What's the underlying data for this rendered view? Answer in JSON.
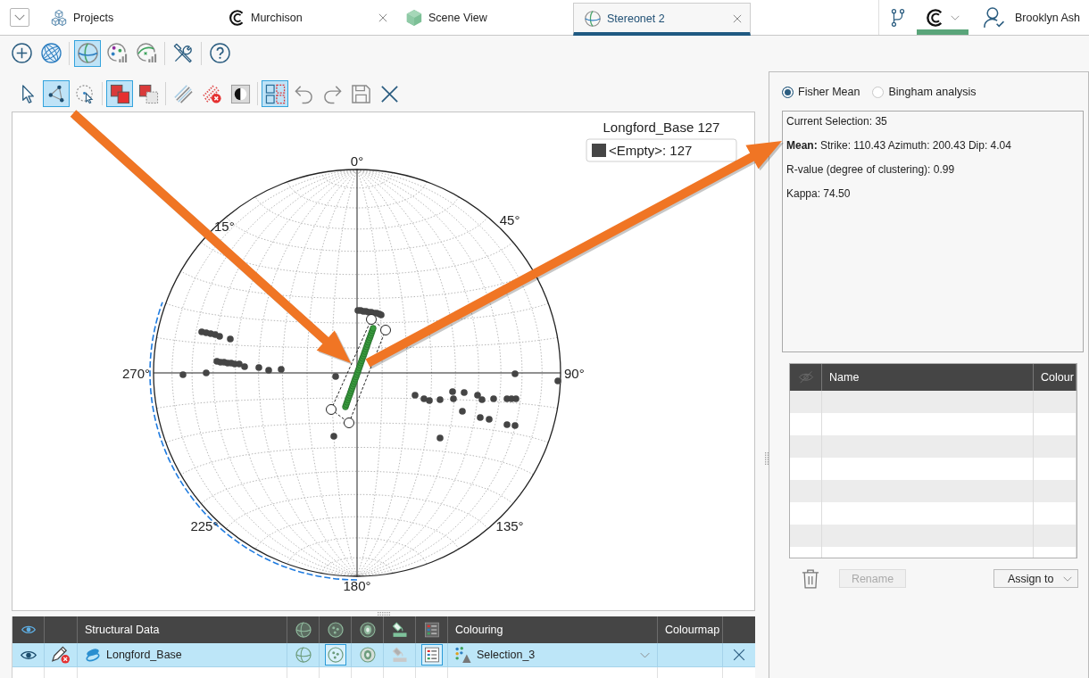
{
  "tab_bar": {
    "tabs": [
      {
        "label": "Projects",
        "kind": "projects",
        "selected": false,
        "closable": false
      },
      {
        "label": "Murchison",
        "kind": "project",
        "selected": false,
        "closable": true
      },
      {
        "label": "Scene View",
        "kind": "scene",
        "selected": false,
        "closable": false
      },
      {
        "label": "Stereonet 2",
        "kind": "stereonet",
        "selected": true,
        "closable": true
      }
    ],
    "app_menu": {
      "highlighted": true
    },
    "user": {
      "name": "Brooklyn Ash"
    }
  },
  "toolbars": [
    [
      [
        {
          "kind": "add",
          "selected": false
        },
        {
          "kind": "globe",
          "selected": false
        }
      ],
      [
        {
          "kind": "stereonet",
          "selected": true
        },
        {
          "kind": "palette-chart",
          "selected": false
        },
        {
          "kind": "fit-chart",
          "selected": false
        }
      ],
      [
        {
          "kind": "tools",
          "selected": false
        }
      ],
      [
        {
          "kind": "help",
          "selected": false
        }
      ]
    ],
    [
      [
        {
          "kind": "select-arrow",
          "selected": false
        },
        {
          "kind": "polygon-select",
          "selected": true
        },
        {
          "kind": "lasso-select",
          "selected": false
        }
      ],
      [
        {
          "kind": "red-squares",
          "selected": true
        },
        {
          "kind": "red-square-dashed",
          "selected": false
        }
      ],
      [
        {
          "kind": "lines",
          "selected": false
        },
        {
          "kind": "lines-remove",
          "selected": false
        },
        {
          "kind": "contrast",
          "selected": false
        }
      ],
      [
        {
          "kind": "grid-select",
          "selected": true
        },
        {
          "kind": "undo",
          "selected": false
        },
        {
          "kind": "redo",
          "selected": false
        },
        {
          "kind": "save",
          "selected": false
        },
        {
          "kind": "close",
          "selected": false
        }
      ]
    ]
  ],
  "stereonet": {
    "compass_labels": [
      "0°",
      "45°",
      "90°",
      "135°",
      "180°",
      "225°",
      "270°",
      "15°"
    ],
    "legend": {
      "title": "Longford_Base 127",
      "entries": [
        {
          "label": "<Empty>: 127",
          "color": "#454545"
        }
      ]
    }
  },
  "layers_table": {
    "columns": [
      {
        "kind": "visibility"
      },
      {
        "kind": "blank"
      },
      {
        "kind": "text",
        "label": "Structural Data"
      },
      {
        "kind": "planes"
      },
      {
        "kind": "poles"
      },
      {
        "kind": "contours"
      },
      {
        "kind": "bucket"
      },
      {
        "kind": "legend"
      },
      {
        "kind": "text",
        "label": "Colouring"
      },
      {
        "kind": "text",
        "label": "Colourmap"
      },
      {
        "kind": "blank"
      }
    ],
    "rows": [
      {
        "selected": true,
        "visible": true,
        "name": "Longford_Base",
        "toggles": [
          {
            "kind": "planes",
            "on": false,
            "disabled": false
          },
          {
            "kind": "poles",
            "on": true,
            "disabled": false
          },
          {
            "kind": "contours",
            "on": false,
            "disabled": false
          },
          {
            "kind": "bucket",
            "on": false,
            "disabled": true
          },
          {
            "kind": "legend",
            "on": true,
            "disabled": false
          }
        ],
        "colouring": "Selection_3"
      }
    ]
  },
  "analysis": {
    "methods": [
      {
        "label": "Fisher Mean",
        "selected": true
      },
      {
        "label": "Bingham analysis",
        "selected": false
      }
    ],
    "results": [
      "Current Selection: 35",
      "**Mean:** Strike: 110.43 Azimuth: 200.43 Dip: 4.04",
      "R-value (degree of clustering): 0.99",
      "Kappa: 74.50"
    ],
    "selection_table": {
      "columns": [
        {
          "kind": "visibility"
        },
        {
          "kind": "text",
          "label": "Name"
        },
        {
          "kind": "text",
          "label": "Colour"
        }
      ]
    },
    "rename_button": {
      "label": "Rename",
      "disabled": true
    },
    "assign_button": {
      "label": "Assign to"
    }
  }
}
